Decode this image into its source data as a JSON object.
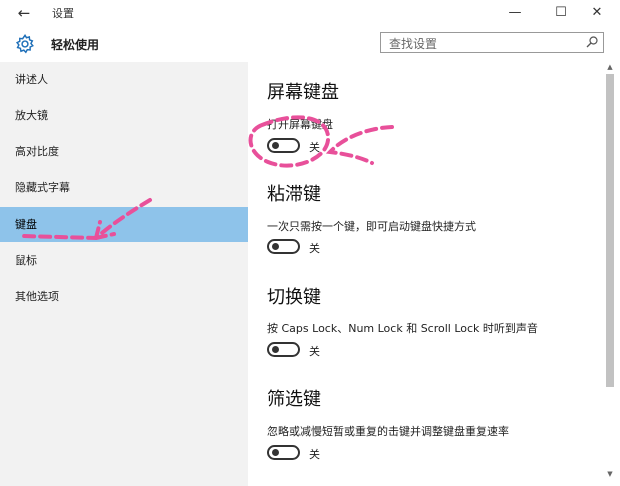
{
  "titlebar": {
    "back_glyph": "←",
    "title": "设置",
    "minimize_glyph": "—",
    "maximize_glyph": "☐",
    "close_glyph": "✕"
  },
  "header": {
    "section_title": "轻松使用",
    "search_placeholder": "查找设置",
    "gear_icon": "gear-icon",
    "search_icon": "search-icon"
  },
  "sidebar": {
    "items": [
      {
        "label": "讲述人",
        "active": false
      },
      {
        "label": "放大镜",
        "active": false
      },
      {
        "label": "高对比度",
        "active": false
      },
      {
        "label": "隐藏式字幕",
        "active": false
      },
      {
        "label": "键盘",
        "active": true
      },
      {
        "label": "鼠标",
        "active": false
      },
      {
        "label": "其他选项",
        "active": false
      }
    ]
  },
  "content": {
    "sections": [
      {
        "title": "屏幕键盘",
        "description": "打开屏幕键盘",
        "toggle_state": "关"
      },
      {
        "title": "粘滞键",
        "description": "一次只需按一个键，即可启动键盘快捷方式",
        "toggle_state": "关"
      },
      {
        "title": "切换键",
        "description": "按 Caps Lock、Num Lock 和 Scroll Lock 时听到声音",
        "toggle_state": "关"
      },
      {
        "title": "筛选键",
        "description": "忽略或减慢短暂或重复的击键并调整键盘重复速率",
        "toggle_state": "关"
      }
    ]
  },
  "colors": {
    "sidebar_bg": "#f2f2f2",
    "active_item_bg": "#8ec3ea",
    "annotation": "#e8509a"
  }
}
